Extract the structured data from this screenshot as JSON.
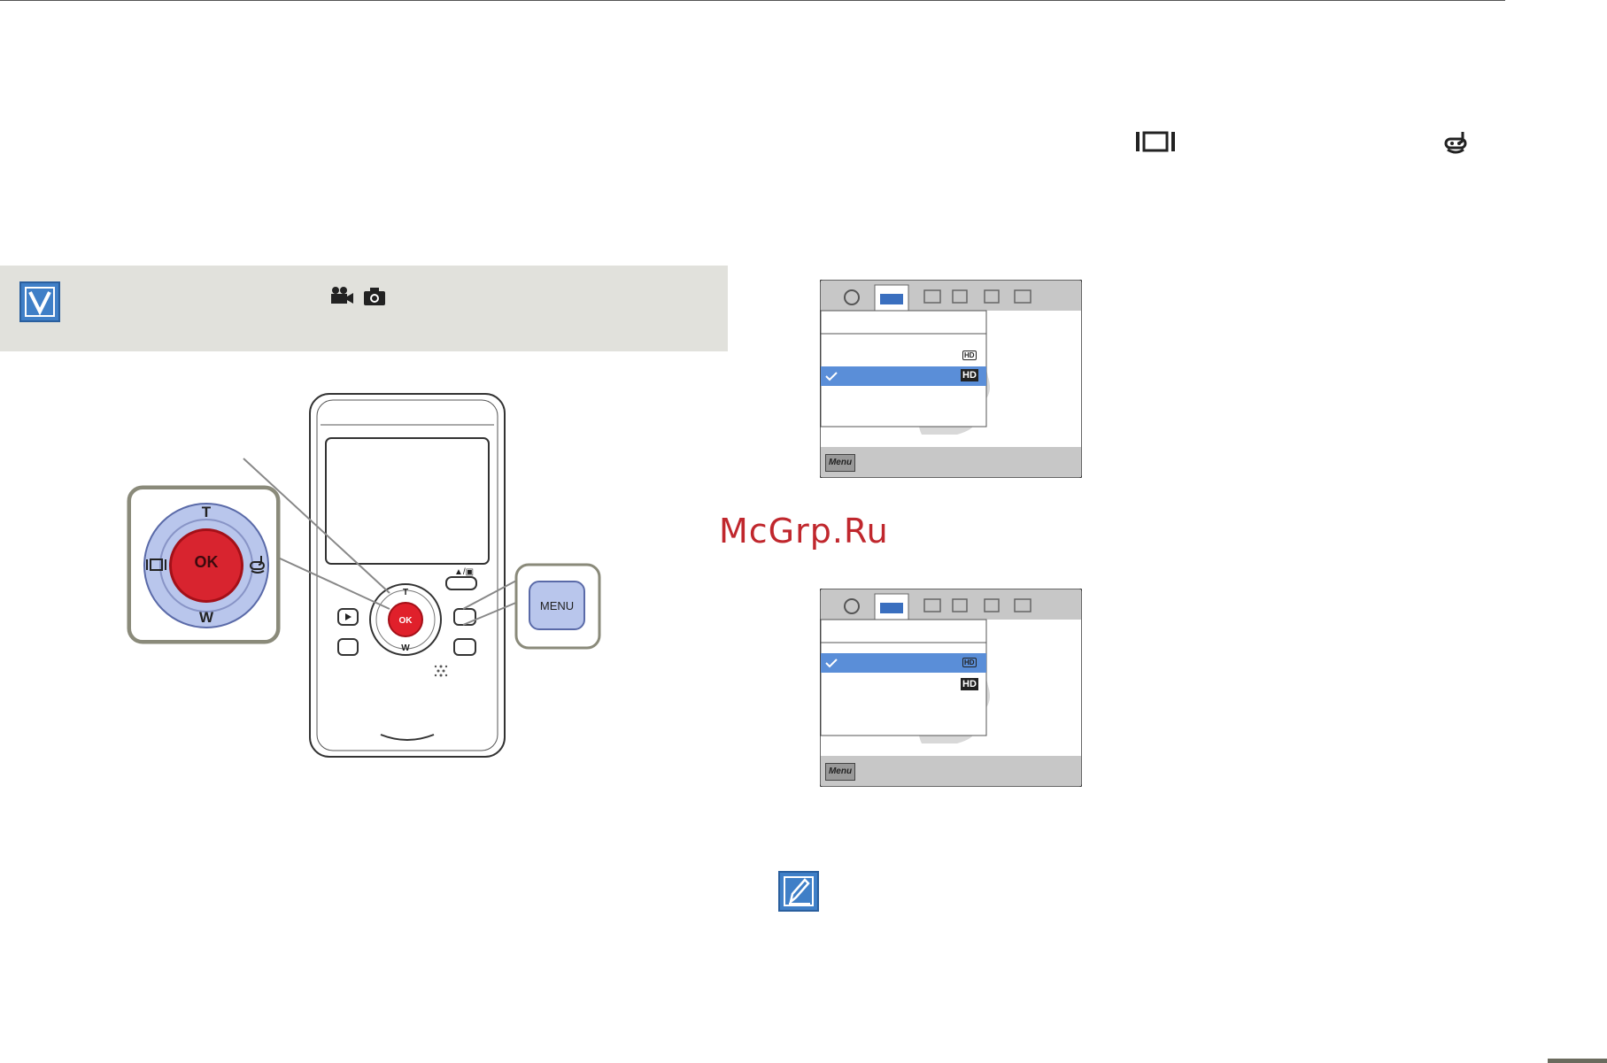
{
  "watermark": {
    "text": "McGrp.Ru"
  },
  "camera": {
    "dial_labels": {
      "tele": "T",
      "wide": "W",
      "ok": "OK"
    },
    "menu_button_label": "MENU"
  },
  "menu_screens": [
    {
      "option_badges": [
        "HD",
        "HD"
      ],
      "menu_key_label": "Menu",
      "selected_row": 2
    },
    {
      "option_badges": [
        "HD",
        "HD"
      ],
      "menu_key_label": "Menu",
      "selected_row": 1
    }
  ],
  "icons": {
    "mode_icons": [
      "movie-camera-icon",
      "photo-camera-icon"
    ],
    "dial_left": "display-icon",
    "dial_right": "diving-mask-icon"
  },
  "colors": {
    "accent_blue": "#3f7fc7",
    "ok_red": "#d8242f",
    "notice_bg": "#e1e1dc",
    "dial_blue": "#b9c6ec"
  }
}
